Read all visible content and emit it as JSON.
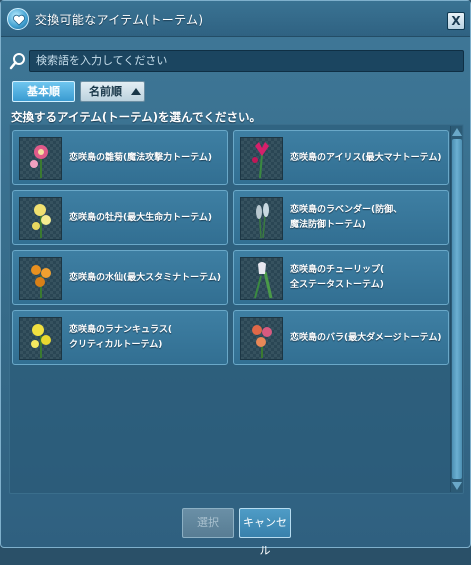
{
  "window": {
    "title": "交換可能なアイテム(トーテム)",
    "close_label": "X"
  },
  "search": {
    "placeholder": "検索語を入力してください"
  },
  "sort": {
    "basic_label": "基本順",
    "name_label": "名前順"
  },
  "instruction": "交換するアイテム(トーテム)を選んでください。",
  "items": [
    {
      "line1": "恋咲島の雛菊(魔法攻撃力トーテム)",
      "line2": "",
      "icon": "daisy-flower-icon",
      "color": "#e05a8a"
    },
    {
      "line1": "恋咲島のアイリス(最大マナトーテム)",
      "line2": "",
      "icon": "iris-flower-icon",
      "color": "#d4206a"
    },
    {
      "line1": "恋咲島の牡丹(最大生命力トーテム)",
      "line2": "",
      "icon": "peony-flower-icon",
      "color": "#f0e070"
    },
    {
      "line1": "恋咲島のラベンダー(防御、",
      "line2": "魔法防御トーテム)",
      "icon": "lavender-flower-icon",
      "color": "#b8c8d0"
    },
    {
      "line1": "恋咲島の水仙(最大スタミナトーテム)",
      "line2": "",
      "icon": "daffodil-flower-icon",
      "color": "#e89020"
    },
    {
      "line1": "恋咲島のチューリップ(",
      "line2": "全ステータストーテム)",
      "icon": "tulip-flower-icon",
      "color": "#e8e8f0"
    },
    {
      "line1": "恋咲島のラナンキュラス(",
      "line2": "クリティカルトーテム)",
      "icon": "ranunculus-flower-icon",
      "color": "#f0e040"
    },
    {
      "line1": "恋咲島のバラ(最大ダメージトーテム)",
      "line2": "",
      "icon": "rose-flower-icon",
      "color": "#e06848"
    }
  ],
  "footer": {
    "select_label": "選択",
    "cancel_label": "キャンセル"
  }
}
